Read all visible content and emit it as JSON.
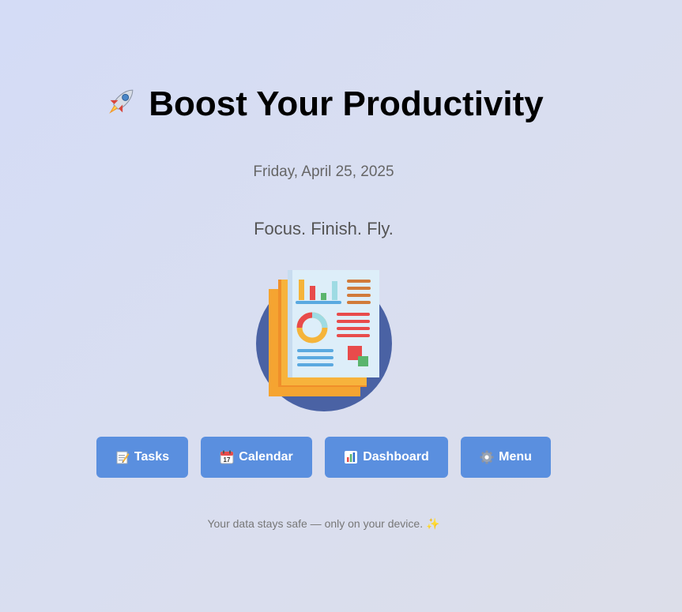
{
  "header": {
    "icon": "rocket-icon",
    "title": "Boost Your Productivity"
  },
  "date": "Friday, April 25, 2025",
  "tagline": "Focus. Finish. Fly.",
  "hero": {
    "icon": "report-document-illustration"
  },
  "buttons": [
    {
      "label": "Tasks",
      "icon": "memo-icon"
    },
    {
      "label": "Calendar",
      "icon": "calendar-icon"
    },
    {
      "label": "Dashboard",
      "icon": "bar-chart-icon"
    },
    {
      "label": "Menu",
      "icon": "gear-icon"
    }
  ],
  "footer": {
    "text": "Your data stays safe — only on your device.",
    "icon": "sparkles-icon"
  },
  "colors": {
    "button": "#5a8fdf",
    "title": "#000000",
    "subtle_text": "#666666"
  }
}
